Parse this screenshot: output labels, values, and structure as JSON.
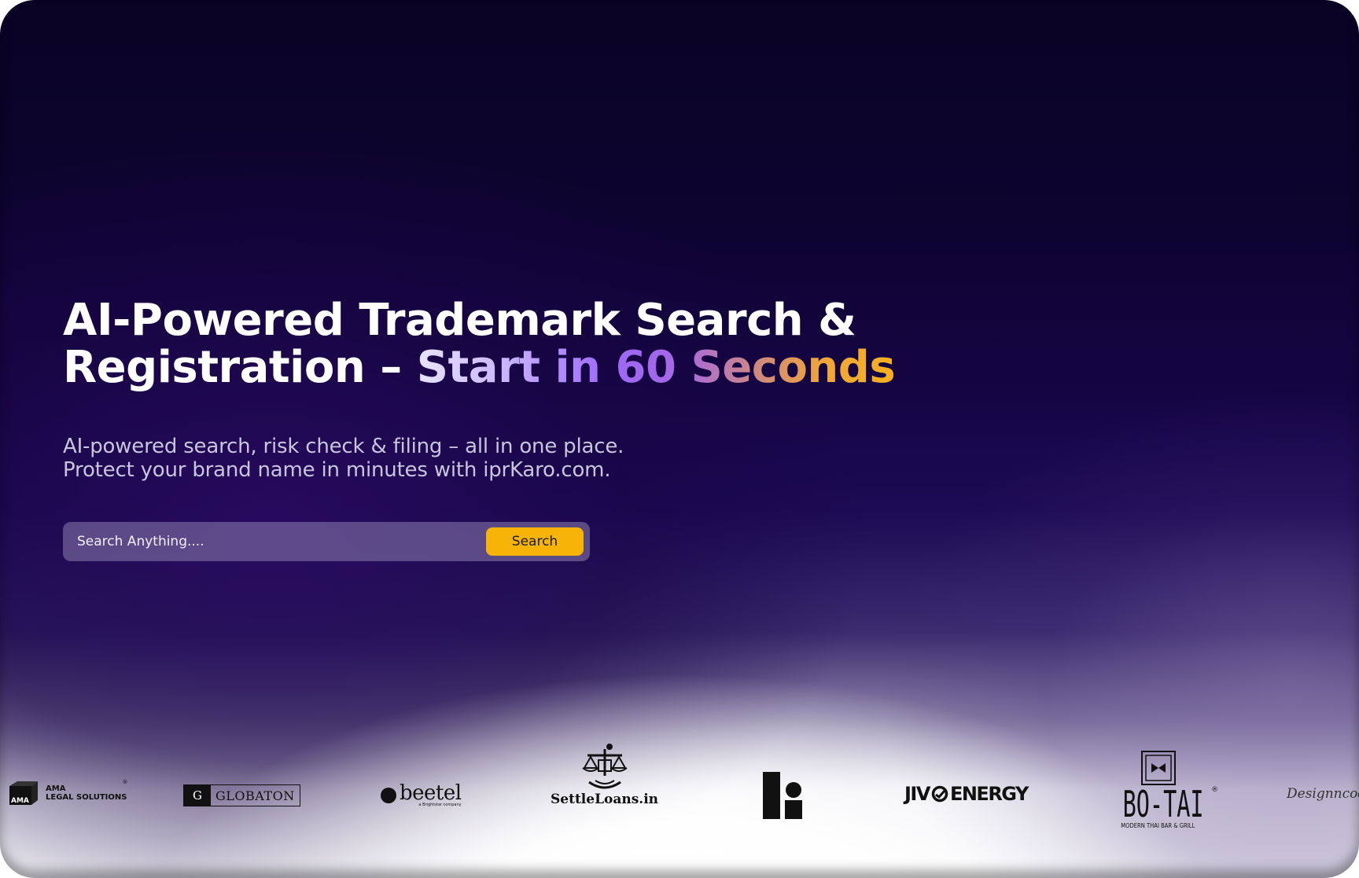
{
  "hero": {
    "headline_line1": "AI-Powered Trademark Search &",
    "headline_line2_plain": "Registration – ",
    "headline_line2_gradient": "Start in 60 Seconds",
    "subtitle_line1": "AI-powered search, risk check & filing – all in one place.",
    "subtitle_line2": "Protect your brand name in minutes with iprKaro.com."
  },
  "search": {
    "placeholder": "Search Anything....",
    "button_label": "Search"
  },
  "logos": {
    "ama": {
      "name": "AMA",
      "line2": "LEGAL SOLUTIONS",
      "mark": "AMA",
      "reg": "®"
    },
    "globaton": {
      "mark": "G",
      "name": "GLOBATON"
    },
    "beetel": {
      "name": "beetel",
      "tagline": "a Brightstar company"
    },
    "settleloans": {
      "name": "SettleLoans.in"
    },
    "jivo": {
      "name_part1": "JIV",
      "name_part2": "ENERGY"
    },
    "botai": {
      "name": "BO-TAI",
      "tagline": "MODERN THAI BAR & GRILL",
      "reg": "®"
    },
    "designcode": {
      "name": "Designncode"
    }
  },
  "colors": {
    "accent": "#f6b406",
    "gradient_start": "#e9e4ff",
    "gradient_mid": "#9c68f6",
    "gradient_end": "#f6b01e"
  }
}
